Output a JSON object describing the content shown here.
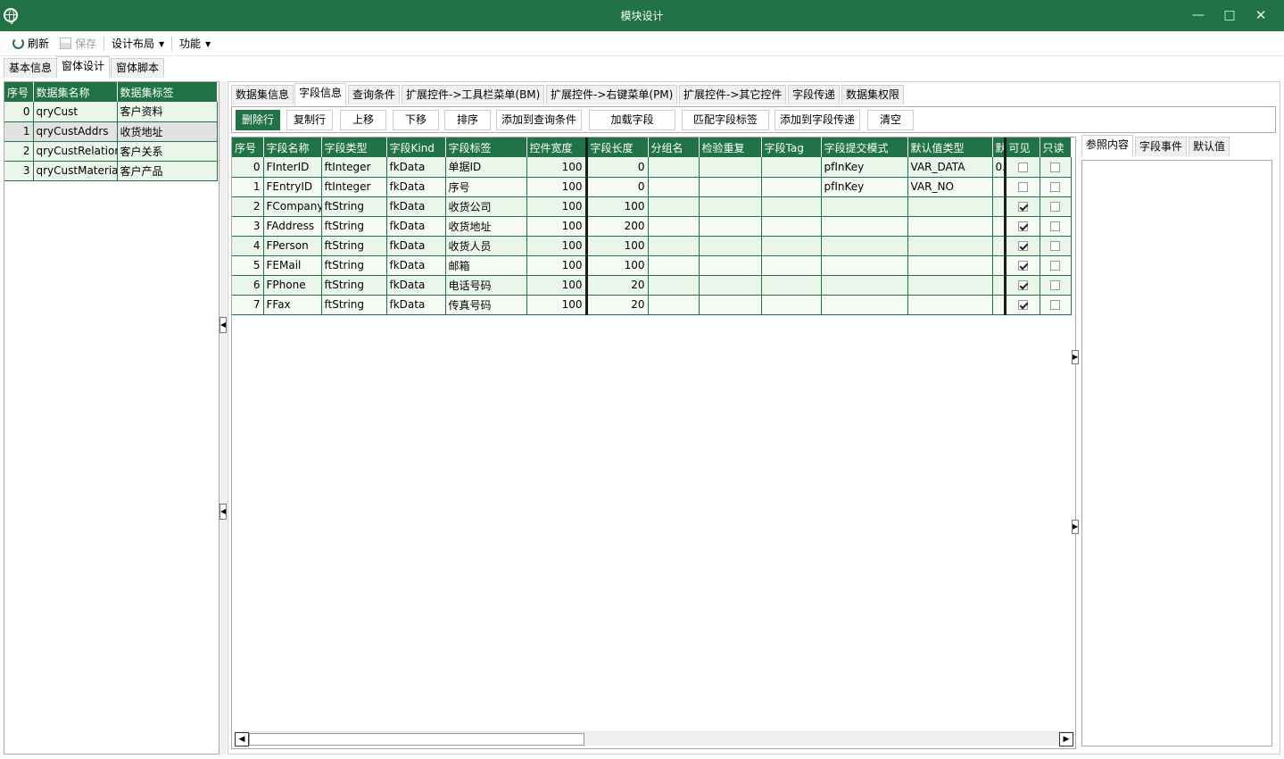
{
  "window": {
    "title": "模块设计"
  },
  "toolbar": {
    "refresh": "刷新",
    "save": "保存",
    "layout": "设计布局",
    "functions": "功能"
  },
  "main_tabs": [
    "基本信息",
    "窗体设计",
    "窗体脚本"
  ],
  "dataset_grid": {
    "headers": [
      "序号",
      "数据集名称",
      "数据集标签"
    ],
    "rows": [
      [
        "0",
        "qryCust",
        "客户资料"
      ],
      [
        "1",
        "qryCustAddrs",
        "收货地址"
      ],
      [
        "2",
        "qryCustRelation",
        "客户关系"
      ],
      [
        "3",
        "qryCustMaterial",
        "客户产品"
      ]
    ]
  },
  "sub_tabs": [
    "数据集信息",
    "字段信息",
    "查询条件",
    "扩展控件->工具栏菜单(BM)",
    "扩展控件->右键菜单(PM)",
    "扩展控件->其它控件",
    "字段传递",
    "数据集权限"
  ],
  "actions": [
    "删除行",
    "复制行",
    "上移",
    "下移",
    "排序",
    "添加到查询条件",
    "加载字段",
    "匹配字段标签",
    "添加到字段传递",
    "清空"
  ],
  "field_grid": {
    "headers": [
      "序号",
      "字段名称",
      "字段类型",
      "字段Kind",
      "字段标签",
      "控件宽度",
      "字段长度",
      "分组名",
      "检验重复",
      "字段Tag",
      "字段提交模式",
      "默认值类型",
      "默",
      "可见",
      "只读"
    ],
    "rows": [
      {
        "idx": "0",
        "name": "FInterID",
        "type": "ftInteger",
        "kind": "fkData",
        "label": "单据ID",
        "width": "100",
        "len": "0",
        "group": "",
        "check": "",
        "tag": "",
        "submit": "pfInKey",
        "deftype": "VAR_DATA",
        "defval": "0.",
        "visible": false,
        "readonly": false
      },
      {
        "idx": "1",
        "name": "FEntryID",
        "type": "ftInteger",
        "kind": "fkData",
        "label": "序号",
        "width": "100",
        "len": "0",
        "group": "",
        "check": "",
        "tag": "",
        "submit": "pfInKey",
        "deftype": "VAR_NO",
        "defval": "",
        "visible": false,
        "readonly": false
      },
      {
        "idx": "2",
        "name": "FCompany",
        "type": "ftString",
        "kind": "fkData",
        "label": "收货公司",
        "width": "100",
        "len": "100",
        "group": "",
        "check": "",
        "tag": "",
        "submit": "",
        "deftype": "",
        "defval": "",
        "visible": true,
        "readonly": false
      },
      {
        "idx": "3",
        "name": "FAddress",
        "type": "ftString",
        "kind": "fkData",
        "label": "收货地址",
        "width": "100",
        "len": "200",
        "group": "",
        "check": "",
        "tag": "",
        "submit": "",
        "deftype": "",
        "defval": "",
        "visible": true,
        "readonly": false
      },
      {
        "idx": "4",
        "name": "FPerson",
        "type": "ftString",
        "kind": "fkData",
        "label": "收货人员",
        "width": "100",
        "len": "100",
        "group": "",
        "check": "",
        "tag": "",
        "submit": "",
        "deftype": "",
        "defval": "",
        "visible": true,
        "readonly": false
      },
      {
        "idx": "5",
        "name": "FEMail",
        "type": "ftString",
        "kind": "fkData",
        "label": "邮箱",
        "width": "100",
        "len": "100",
        "group": "",
        "check": "",
        "tag": "",
        "submit": "",
        "deftype": "",
        "defval": "",
        "visible": true,
        "readonly": false
      },
      {
        "idx": "6",
        "name": "FPhone",
        "type": "ftString",
        "kind": "fkData",
        "label": "电话号码",
        "width": "100",
        "len": "20",
        "group": "",
        "check": "",
        "tag": "",
        "submit": "",
        "deftype": "",
        "defval": "",
        "visible": true,
        "readonly": false
      },
      {
        "idx": "7",
        "name": "FFax",
        "type": "ftString",
        "kind": "fkData",
        "label": "传真号码",
        "width": "100",
        "len": "20",
        "group": "",
        "check": "",
        "tag": "",
        "submit": "",
        "deftype": "",
        "defval": "",
        "visible": true,
        "readonly": false
      }
    ]
  },
  "side_tabs": [
    "参照内容",
    "字段事件",
    "默认值"
  ],
  "colors": {
    "accent": "#217346",
    "row_even": "#e9f6e9",
    "row_odd": "#f6fbf6",
    "row_selected": "#e2e2e2"
  }
}
